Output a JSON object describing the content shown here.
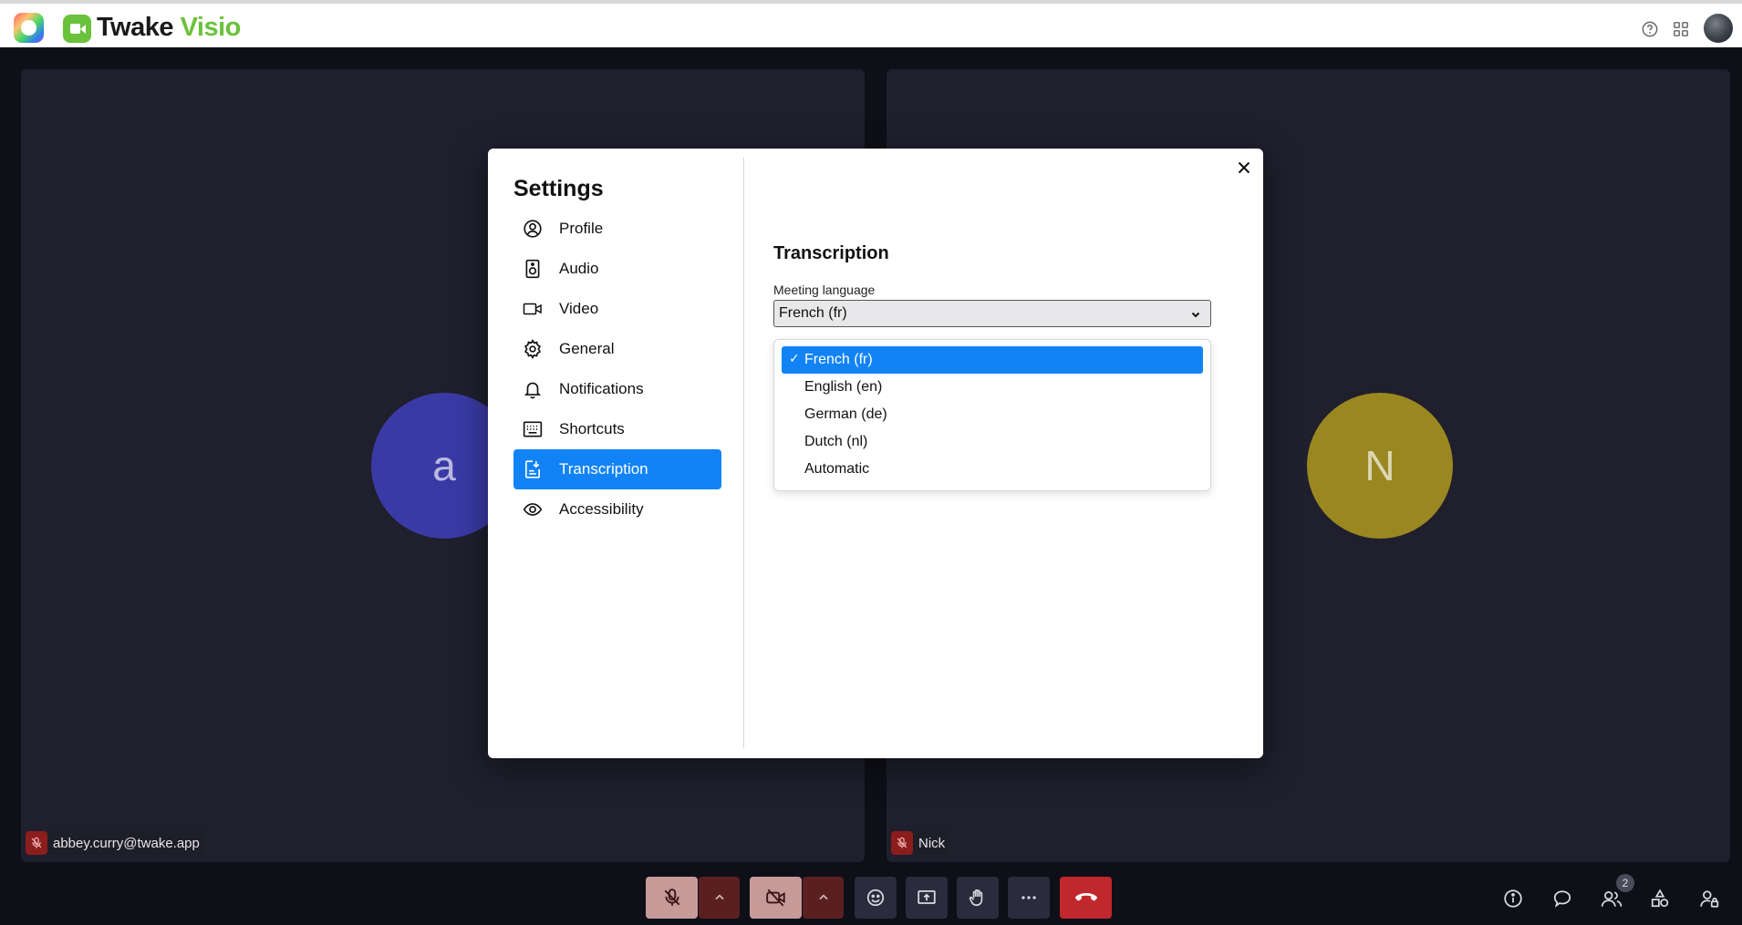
{
  "app": {
    "name_main": "Twake",
    "name_accent": "Visio",
    "brand_color": "#6ac13a"
  },
  "topbar": {
    "icons": [
      "app-launcher-icon",
      "help-icon",
      "apps-grid-icon",
      "user-avatar"
    ]
  },
  "participants": [
    {
      "initial": "a",
      "name": "abbey.curry@twake.app",
      "avatar_color": "#3a3aa6",
      "mic": "muted"
    },
    {
      "initial": "N",
      "name": "Nick",
      "avatar_color": "#9a8720",
      "mic": "muted"
    }
  ],
  "toolbar": {
    "controls": [
      "mic-off-icon",
      "chevron-up-icon",
      "camera-off-icon",
      "chevron-up-icon",
      "emoji-icon",
      "screen-share-icon",
      "raise-hand-icon",
      "more-icon",
      "hang-up-icon"
    ],
    "right_icons": [
      "info-icon",
      "chat-icon",
      "participants-icon",
      "tools-icon",
      "admin-icon"
    ],
    "participant_count": "2",
    "hangup_color": "#c0282d"
  },
  "settings": {
    "title": "Settings",
    "nav": [
      {
        "label": "Profile",
        "icon": "profile-icon"
      },
      {
        "label": "Audio",
        "icon": "speaker-icon"
      },
      {
        "label": "Video",
        "icon": "video-icon"
      },
      {
        "label": "General",
        "icon": "gear-icon"
      },
      {
        "label": "Notifications",
        "icon": "bell-icon"
      },
      {
        "label": "Shortcuts",
        "icon": "keyboard-icon"
      },
      {
        "label": "Transcription",
        "icon": "transcription-icon",
        "active": true
      },
      {
        "label": "Accessibility",
        "icon": "eye-icon"
      }
    ],
    "active_color": "#1283f7",
    "section_title": "Transcription",
    "field_label": "Meeting language",
    "selected_value": "French (fr)",
    "options": [
      {
        "label": "French (fr)",
        "selected": true
      },
      {
        "label": "English (en)"
      },
      {
        "label": "German (de)"
      },
      {
        "label": "Dutch (nl)"
      },
      {
        "label": "Automatic"
      }
    ]
  }
}
